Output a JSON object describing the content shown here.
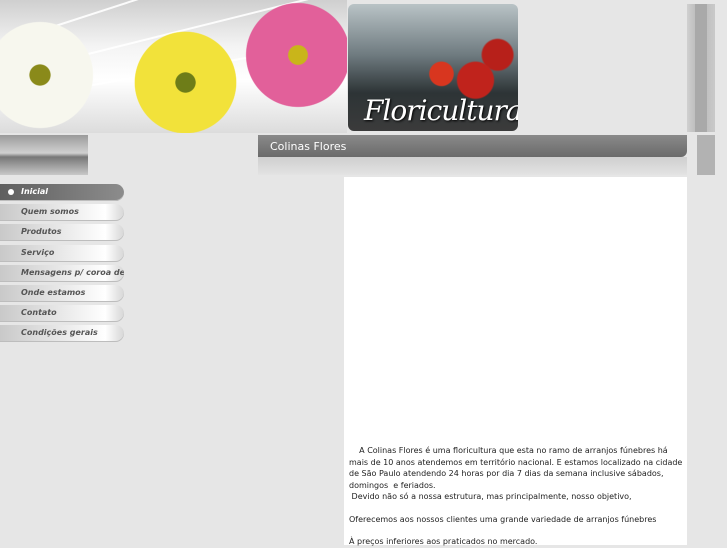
{
  "header": {
    "photo_title": "Floricultura"
  },
  "title_bar": {
    "title": "Colinas Flores"
  },
  "nav": {
    "items": [
      {
        "label": "Inicial",
        "active": true
      },
      {
        "label": "Quem somos",
        "active": false
      },
      {
        "label": "Produtos",
        "active": false
      },
      {
        "label": "Serviço",
        "active": false
      },
      {
        "label": "Mensagens p/ coroa de fl",
        "active": false
      },
      {
        "label": "Onde estamos",
        "active": false
      },
      {
        "label": "Contato",
        "active": false
      },
      {
        "label": "Condições gerais",
        "active": false
      }
    ]
  },
  "content": {
    "paragraphs": [
      "    A Colinas Flores é uma floricultura que esta no ramo de arranjos fúnebres há mais de 10 anos atendemos em território nacional. E estamos localizado na cidade de São Paulo atendendo 24 horas por dia 7 dias da semana inclusive sábados, domingos  e feriados.",
      " Devido não só a nossa estrutura, mas principalmente, nosso objetivo,",
      "Oferecemos aos nossos clientes uma grande variedade de arranjos fúnebres",
      "À preços inferiores aos praticados no mercado."
    ]
  },
  "colors": {
    "page_background": "#e6e6e6",
    "title_bar": "#7a7a7a",
    "nav_active": "#6e6e6e",
    "content_background": "#ffffff"
  }
}
